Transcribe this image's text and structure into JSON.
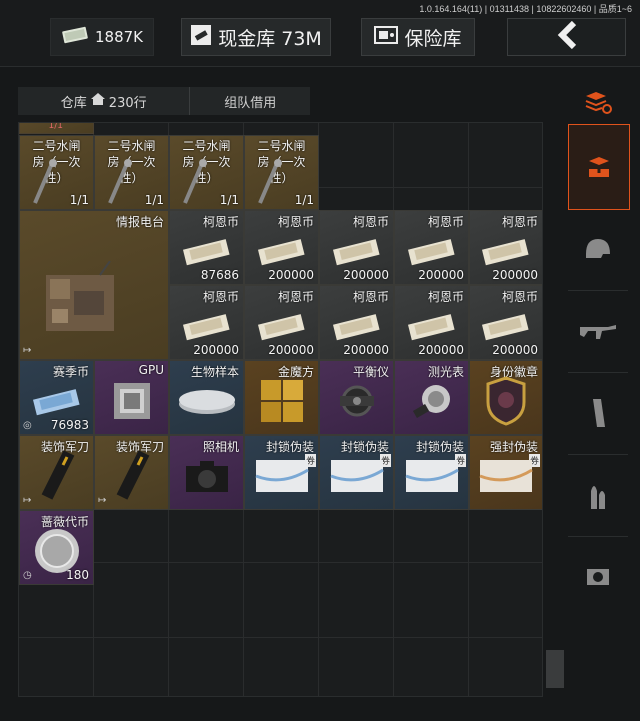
{
  "version": "1.0.164.164(11) | 01311438 | 10822602460 | 品质1~6",
  "header": {
    "cash_amount": "1887K",
    "vault_label": "现金库 73M",
    "safe_label": "保险库"
  },
  "tabs": {
    "warehouse": "仓库",
    "rows": "230行",
    "team_loan": "组队借用"
  },
  "items": {
    "top_strip": "1/1",
    "water_gate_name": "二号水闸房（一次性）",
    "water_gate_name_lines": [
      "二号水闸",
      "房（一次",
      "性）"
    ],
    "water_gate_count": "1/1",
    "radio_name": "情报电台",
    "coin_name": "柯恩币",
    "coin_values": [
      "87686",
      "200000",
      "200000",
      "200000",
      "200000",
      "200000",
      "200000",
      "200000",
      "200000",
      "200000"
    ],
    "season_coin_name": "赛季币",
    "season_coin_value": "76983",
    "gpu_name": "GPU",
    "bio_name": "生物样本",
    "cube_name": "金魔方",
    "gyro_name": "平衡仪",
    "meter_name": "测光表",
    "badge_name": "身份徽章",
    "knife_name": "装饰军刀",
    "camera_name": "照相机",
    "seal_name": "封锁伪装",
    "seal_tag": "券",
    "strong_seal_name": "强封伪装",
    "rose_coin_name": "蔷薇代币",
    "rose_coin_value": "180"
  },
  "colors": {
    "accent": "#e0531c",
    "gold_rarity": "#5a4a2a",
    "purple_rarity": "#4a2f56",
    "grey_rarity": "#3c3e3e",
    "blue_rarity": "#2e3e4e",
    "orange_rarity": "#5a4220"
  },
  "sidebar_icons": [
    "stack-refresh-icon",
    "inbox-download-icon",
    "helmet-icon",
    "rifle-icon",
    "magazine-icon",
    "ammo-icon",
    "scope-icon"
  ]
}
